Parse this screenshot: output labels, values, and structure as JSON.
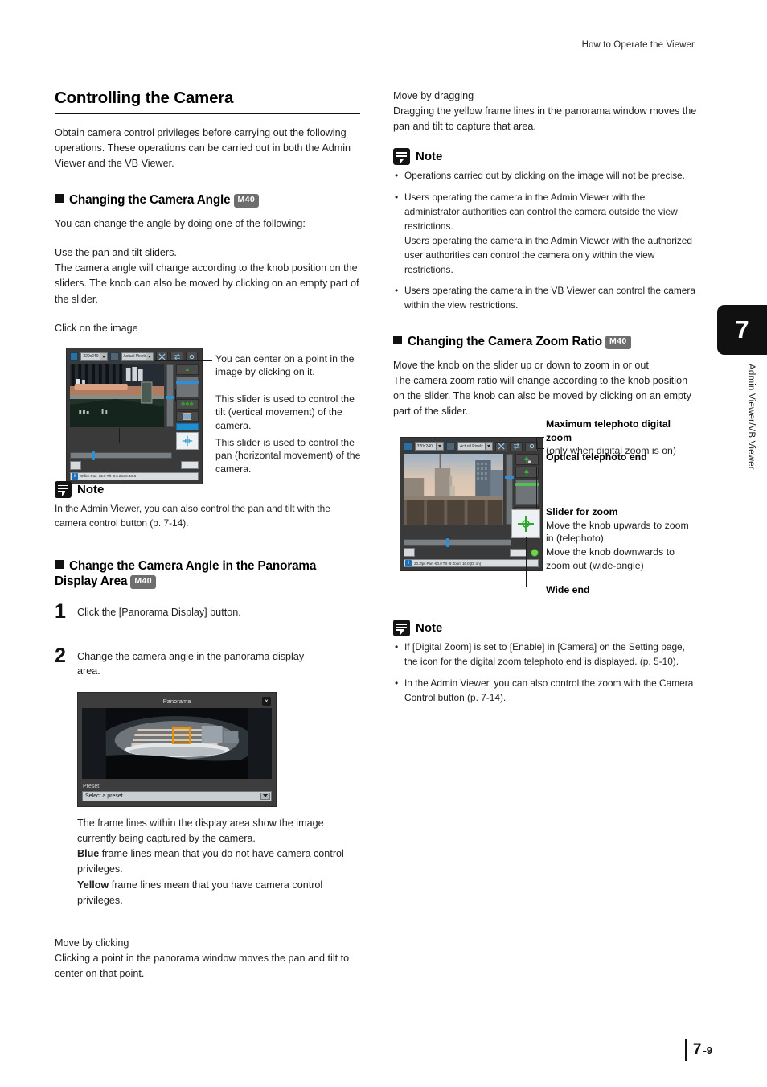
{
  "header": {
    "running_head": "How to Operate the Viewer"
  },
  "footer": {
    "page_num": "7",
    "page_sub": "-9"
  },
  "chapter_tab": {
    "number": "7",
    "label": "Admin Viewer/VB Viewer"
  },
  "left": {
    "section_title": "Controlling the Camera",
    "intro": "Obtain camera control privileges before carrying out the following operations. These operations can be carried out in both the Admin Viewer and the VB Viewer.",
    "head_camera_angle": "Changing the Camera Angle",
    "badge_m40": "M40",
    "angle_intro": "You can change the angle by doing one of the following:",
    "sliders_head": "Use the pan and tilt sliders.",
    "sliders_body": "The camera angle will change according to the knob position on the sliders. The knob can also be moved by clicking on an empty part of the slider.",
    "click_image_head": "Click on the image",
    "callout_center": "You can center on a point in the image by clicking on it.",
    "callout_tilt": "This slider is used to control the tilt (vertical movement) of the camera.",
    "callout_pan": "This slider is used to control the pan (horizontal movement) of the camera.",
    "note_title": "Note",
    "note_body": "In the Admin Viewer, you can also control the pan and tilt with the camera control button (p. 7-14).",
    "head_panorama": "Change the Camera Angle in the Panorama Display Area",
    "step1_num": "1",
    "step1_text": "Click the [Panorama Display] button.",
    "step2_num": "2",
    "step2_text": "Change the camera angle in the panorama display area.",
    "frame_text_1": "The frame lines within the display area show the image currently being captured by the camera.",
    "frame_blue_word": "Blue",
    "frame_blue_rest": " frame lines mean that you do not have camera control privileges.",
    "frame_yellow_word": "Yellow",
    "frame_yellow_rest": " frame lines mean that you have camera control privileges.",
    "move_click_head": "Move by clicking",
    "move_click_body": "Clicking a point in the panorama window moves the pan and tilt to center on that point.",
    "viewer_shot": {
      "resolution_value": "320x240",
      "size_value": "Actual Pixels",
      "status": "Office  Pan -52.5 Tilt -9.5 Zoom 16.6"
    },
    "panorama_window": {
      "title": "Panorama",
      "close": "×",
      "preset_label": "Preset:",
      "preset_value": "Select a preset."
    }
  },
  "right": {
    "move_drag_head": "Move by dragging",
    "move_drag_body": "Dragging the yellow frame lines in the panorama window moves the pan and tilt to capture that area.",
    "note1_title": "Note",
    "note1_items": [
      "Operations carried out by clicking on the image will not be precise.",
      "Users operating the camera in the Admin Viewer with the administrator authorities can control the camera outside the view restrictions.\nUsers operating the camera in the Admin Viewer with the authorized user authorities can control the camera only within the view restrictions.",
      "Users operating the camera in the VB Viewer can control the camera within the view restrictions."
    ],
    "head_zoom_ratio": "Changing the Camera Zoom Ratio",
    "badge_m40": "M40",
    "zoom_head_line": "Move the knob on the slider up or down to zoom in or out",
    "zoom_body": "The camera zoom ratio will change according to the knob position on the slider. The knob can also be moved by clicking on an empty part of the slider.",
    "callout_max_tele_bold": "Maximum telephoto digital zoom",
    "callout_max_tele_sub": "(only when digital zoom is on)",
    "callout_optical": "Optical telephoto end",
    "callout_slider_bold": "Slider for zoom",
    "callout_slider_sub": "Move the knob upwards to zoom in (telephoto)\nMove the knob downwards to zoom out (wide-angle)",
    "callout_wide": "Wide end",
    "note2_title": "Note",
    "note2_items": [
      "If [Digital Zoom] is set to [Enable] in [Camera] on the Setting page, the icon for the digital zoom telephoto end is displayed. (p. 5-10).",
      "In the Admin Viewer, you can also control the zoom with the Camera Control button (p. 7-14)."
    ],
    "viewer_shot": {
      "resolution_value": "320x240",
      "size_value": "Actual Pixels",
      "status": "20.2fps  Pan -60.0 Tilt -9  Zoom 16.0 (D: on)"
    }
  },
  "colors": {
    "badge_bg": "#6e6e6e",
    "accent_blue": "#2f8fd6",
    "frame_yellow": "#e8900f",
    "ink": "#1f1f1f"
  }
}
